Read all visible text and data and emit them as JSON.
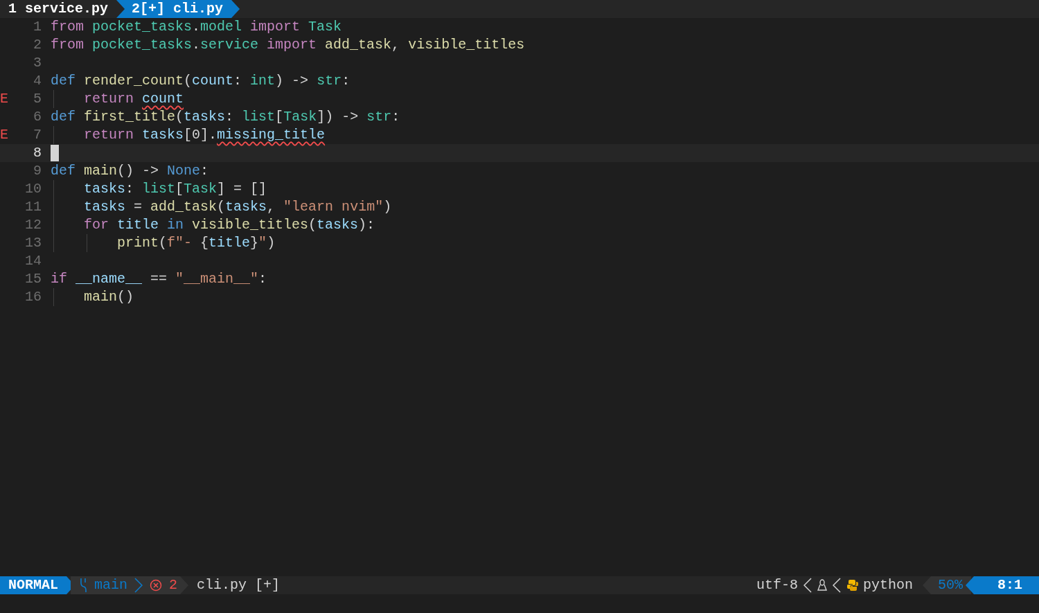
{
  "tabs": [
    {
      "label": "1 service.py",
      "selected": false
    },
    {
      "label": "2[+] cli.py",
      "selected": true
    }
  ],
  "lines": [
    {
      "number": "1",
      "tokens": [
        {
          "text": "from ",
          "kind": "keyword"
        },
        {
          "text": "pocket_tasks",
          "kind": "module"
        },
        {
          "text": ".",
          "kind": "plain"
        },
        {
          "text": "model ",
          "kind": "module"
        },
        {
          "text": "import ",
          "kind": "keyword"
        },
        {
          "text": "Task",
          "kind": "type"
        }
      ]
    },
    {
      "number": "2",
      "tokens": [
        {
          "text": "from ",
          "kind": "keyword"
        },
        {
          "text": "pocket_tasks",
          "kind": "module"
        },
        {
          "text": ".",
          "kind": "plain"
        },
        {
          "text": "service ",
          "kind": "module"
        },
        {
          "text": "import ",
          "kind": "keyword"
        },
        {
          "text": "add_task",
          "kind": "func"
        },
        {
          "text": ", ",
          "kind": "plain"
        },
        {
          "text": "visible_titles",
          "kind": "func"
        }
      ]
    },
    {
      "number": "3"
    },
    {
      "number": "4",
      "tokens": [
        {
          "text": "def ",
          "kind": "def"
        },
        {
          "text": "render_count",
          "kind": "func"
        },
        {
          "text": "(",
          "kind": "plain"
        },
        {
          "text": "count",
          "kind": "var"
        },
        {
          "text": ": ",
          "kind": "plain"
        },
        {
          "text": "int",
          "kind": "type"
        },
        {
          "text": ") -> ",
          "kind": "plain"
        },
        {
          "text": "str",
          "kind": "type"
        },
        {
          "text": ":",
          "kind": "plain"
        }
      ]
    },
    {
      "number": "5",
      "sign": "E",
      "tokens": [
        {
          "text": "    return ",
          "kind": "keyword"
        },
        {
          "text": "count",
          "kind": "var",
          "error": true
        }
      ]
    },
    {
      "number": "6",
      "tokens": [
        {
          "text": "def ",
          "kind": "def"
        },
        {
          "text": "first_title",
          "kind": "func"
        },
        {
          "text": "(",
          "kind": "plain"
        },
        {
          "text": "tasks",
          "kind": "var"
        },
        {
          "text": ": ",
          "kind": "plain"
        },
        {
          "text": "list",
          "kind": "type"
        },
        {
          "text": "[",
          "kind": "plain"
        },
        {
          "text": "Task",
          "kind": "type"
        },
        {
          "text": "]) -> ",
          "kind": "plain"
        },
        {
          "text": "str",
          "kind": "type"
        },
        {
          "text": ":",
          "kind": "plain"
        }
      ]
    },
    {
      "number": "7",
      "sign": "E",
      "tokens": [
        {
          "text": "    return ",
          "kind": "keyword"
        },
        {
          "text": "tasks",
          "kind": "var"
        },
        {
          "text": "[0].",
          "kind": "plain"
        },
        {
          "text": "missing_title",
          "kind": "var",
          "error": true
        }
      ]
    },
    {
      "number": "8",
      "current": true
    },
    {
      "number": "9",
      "tokens": [
        {
          "text": "def ",
          "kind": "def"
        },
        {
          "text": "main",
          "kind": "func"
        },
        {
          "text": "() -> ",
          "kind": "plain"
        },
        {
          "text": "None",
          "kind": "def"
        },
        {
          "text": ":",
          "kind": "plain"
        }
      ]
    },
    {
      "number": "10",
      "tokens": [
        {
          "text": "    tasks",
          "kind": "var"
        },
        {
          "text": ": ",
          "kind": "plain"
        },
        {
          "text": "list",
          "kind": "type"
        },
        {
          "text": "[",
          "kind": "plain"
        },
        {
          "text": "Task",
          "kind": "type"
        },
        {
          "text": "] = []",
          "kind": "plain"
        }
      ]
    },
    {
      "number": "11",
      "tokens": [
        {
          "text": "    tasks",
          "kind": "var"
        },
        {
          "text": " = ",
          "kind": "plain"
        },
        {
          "text": "add_task",
          "kind": "func"
        },
        {
          "text": "(",
          "kind": "plain"
        },
        {
          "text": "tasks",
          "kind": "var"
        },
        {
          "text": ", ",
          "kind": "plain"
        },
        {
          "text": "\"learn nvim\"",
          "kind": "string"
        },
        {
          "text": ")",
          "kind": "plain"
        }
      ]
    },
    {
      "number": "12",
      "tokens": [
        {
          "text": "    for ",
          "kind": "keyword"
        },
        {
          "text": "title",
          "kind": "var"
        },
        {
          "text": " in ",
          "kind": "def"
        },
        {
          "text": "visible_titles",
          "kind": "func"
        },
        {
          "text": "(",
          "kind": "plain"
        },
        {
          "text": "tasks",
          "kind": "var"
        },
        {
          "text": "):",
          "kind": "plain"
        }
      ]
    },
    {
      "number": "13",
      "tokens": [
        {
          "text": "        print",
          "kind": "func"
        },
        {
          "text": "(",
          "kind": "plain"
        },
        {
          "text": "f\"- ",
          "kind": "string"
        },
        {
          "text": "{",
          "kind": "plain"
        },
        {
          "text": "title",
          "kind": "var"
        },
        {
          "text": "}",
          "kind": "plain"
        },
        {
          "text": "\"",
          "kind": "string"
        },
        {
          "text": ")",
          "kind": "plain"
        }
      ]
    },
    {
      "number": "14"
    },
    {
      "number": "15",
      "tokens": [
        {
          "text": "if ",
          "kind": "keyword"
        },
        {
          "text": "__name__",
          "kind": "var"
        },
        {
          "text": " == ",
          "kind": "plain"
        },
        {
          "text": "\"__main__\"",
          "kind": "string"
        },
        {
          "text": ":",
          "kind": "plain"
        }
      ]
    },
    {
      "number": "16",
      "tokens": [
        {
          "text": "    main",
          "kind": "func"
        },
        {
          "text": "()",
          "kind": "plain"
        }
      ]
    }
  ],
  "status_bar": {
    "mode": "NORMAL",
    "branch": "main",
    "errors": "2",
    "file": "cli.py",
    "modified": "[+]",
    "encoding": "utf-8",
    "filetype": "python",
    "percent": "50%",
    "position": "8:1"
  }
}
